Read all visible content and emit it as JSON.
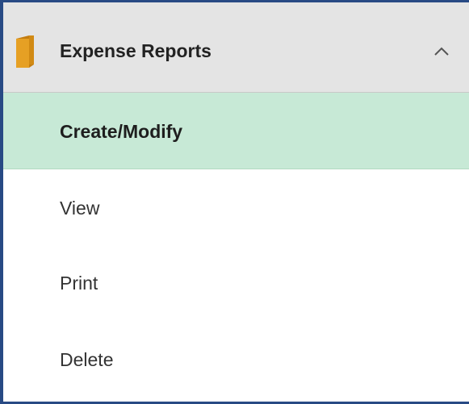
{
  "section": {
    "title": "Expense Reports",
    "icon": "folder-icon",
    "expanded": true,
    "toggle_icon": "chevron-up-icon"
  },
  "menu": {
    "items": [
      {
        "label": "Create/Modify",
        "selected": true
      },
      {
        "label": "View",
        "selected": false
      },
      {
        "label": "Print",
        "selected": false
      },
      {
        "label": "Delete",
        "selected": false
      }
    ]
  },
  "colors": {
    "border": "#284a84",
    "header_bg": "#e4e4e4",
    "selected_bg": "#c7e9d6",
    "folder": "#e6a024"
  }
}
